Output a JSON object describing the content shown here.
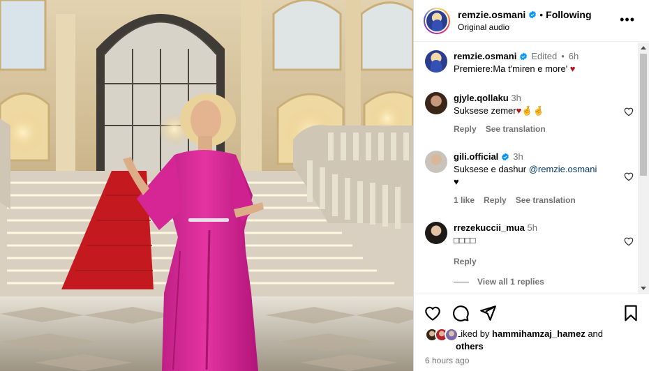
{
  "header": {
    "username": "remzie.osmani",
    "separator": "•",
    "follow_status": "Following",
    "audio": "Original audio",
    "more_label": "•••"
  },
  "caption": {
    "username": "remzie.osmani",
    "edited": "Edited",
    "separator": "•",
    "age": "6h",
    "text": "Premiere:Ma t'miren e more' ♥"
  },
  "comments": [
    {
      "username": "gjyle.qollaku",
      "age": "3h",
      "text": "Suksese zemer♥🤞🤞",
      "reply": "Reply",
      "translate": "See translation"
    },
    {
      "username": "gili.official",
      "age": "3h",
      "text_pre": "Suksese e dashur ",
      "mention": "@remzie.osmani",
      "text_post": "♥",
      "likes": "1 like",
      "reply": "Reply",
      "translate": "See translation"
    },
    {
      "username": "rrezekuccii_mua",
      "age": "5h",
      "text": "□□□□",
      "reply": "Reply"
    }
  ],
  "view_replies": "View all 1 replies",
  "likes": {
    "prefix": "Liked by ",
    "user": "hammihamzaj_hamez",
    "suffix": " and",
    "others": "others"
  },
  "timestamp": "6 hours ago",
  "icons": [
    "heart-icon",
    "comment-icon",
    "share-icon",
    "save-icon",
    "verified-icon",
    "more-icon"
  ],
  "colors": {
    "verified": "#0095f6",
    "heart": "#b0151f",
    "muted": "#737373",
    "mention": "#00376b"
  }
}
